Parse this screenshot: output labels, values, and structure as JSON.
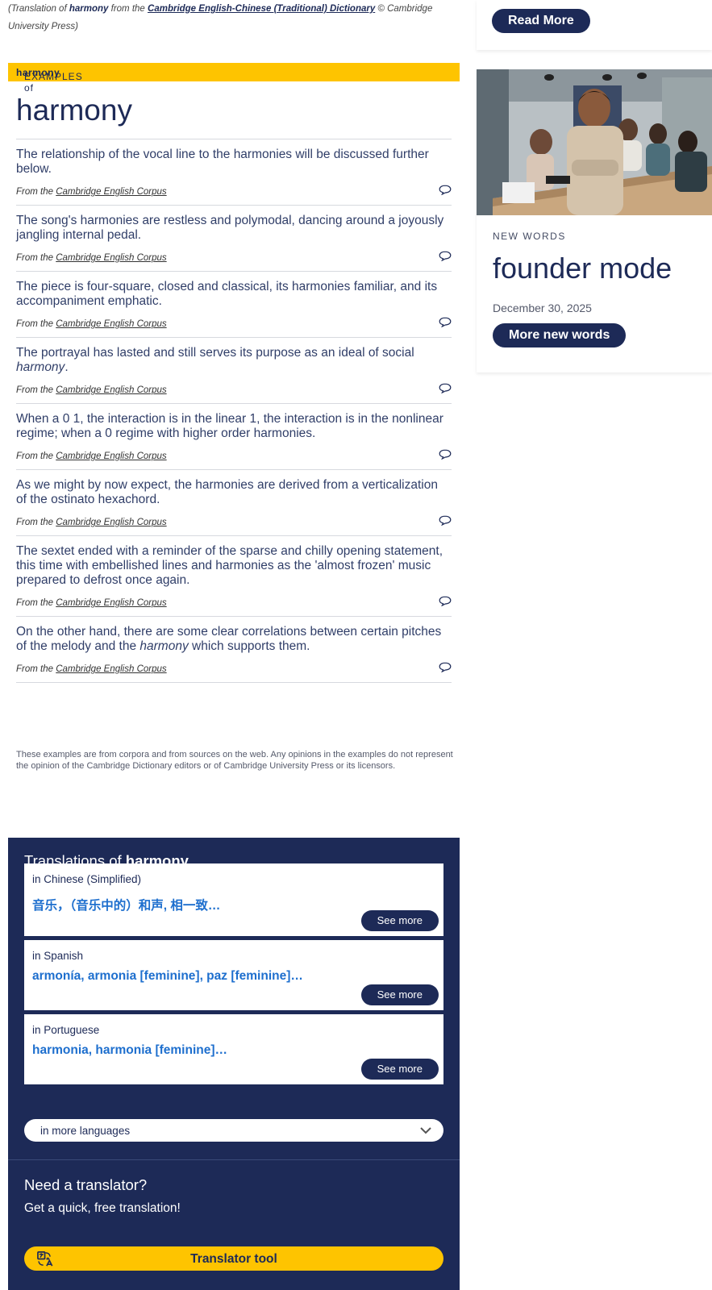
{
  "attribution": {
    "open": "(Translation of ",
    "word": "harmony",
    "from_the": " from the ",
    "dictionary": "Cambridge English-Chinese (Traditional) Dictionary",
    "close": " © Cambridge University Press)"
  },
  "examples": {
    "header_prefix": "EXAMPLES of ",
    "header_word": "harmony",
    "word": "harmony",
    "source_prefix": "From the ",
    "source_link": "Cambridge English Corpus",
    "items": [
      {
        "before": "The relationship of the vocal line to the harmonies will be discussed further below.",
        "em": "",
        "after": ""
      },
      {
        "before": "The song's harmonies are restless and polymodal, dancing around a joyously jangling internal pedal.",
        "em": "",
        "after": ""
      },
      {
        "before": "The piece is four-square, closed and classical, its harmonies familiar, and its accompaniment emphatic.",
        "em": "",
        "after": ""
      },
      {
        "before": "The portrayal has lasted and still serves its purpose as an ideal of social ",
        "em": "harmony",
        "after": "."
      },
      {
        "before": "When a 0 1, the interaction is in the linear 1, the interaction is in the nonlinear regime; when a 0 regime with higher order harmonies.",
        "em": "",
        "after": ""
      },
      {
        "before": "As we might by now expect, the harmonies are derived from a verticalization of the ostinato hexachord.",
        "em": "",
        "after": ""
      },
      {
        "before": "The sextet ended with a reminder of the sparse and chilly opening statement, this time with embellished lines and harmonies as the 'almost frozen' music prepared to defrost once again.",
        "em": "",
        "after": ""
      },
      {
        "before": "On the other hand, there are some clear correlations between certain pitches of the melody and the ",
        "em": "harmony",
        "after": " which supports them."
      }
    ],
    "disclaimer": "These examples are from corpora and from sources on the web. Any opinions in the examples do not represent the opinion of the Cambridge Dictionary editors or of Cambridge University Press or its licensors."
  },
  "translations": {
    "title_prefix": "Translations of ",
    "title_word": "harmony",
    "cards": [
      {
        "lang": "in Chinese (Simplified)",
        "words": "音乐，（音乐中的）和声, 相一致…",
        "button": "See more"
      },
      {
        "lang": "in Spanish",
        "words": "armonía, armonia [feminine], paz [feminine]…",
        "button": "See more"
      },
      {
        "lang": "in Portuguese",
        "words": "harmonia, harmonia [feminine]…",
        "button": "See more"
      }
    ],
    "more_languages": "in more languages",
    "need_translator": "Need a translator?",
    "quick_translation": "Get a quick, free translation!",
    "tool_button": "Translator tool"
  },
  "sidebar": {
    "read_more": "Read More",
    "new_words_label": "NEW WORDS",
    "new_word": "founder mode",
    "date": "December 30, 2025",
    "more_new_words": "More new words"
  },
  "colors": {
    "navy": "#1d2a57",
    "yellow": "#fec400",
    "link_blue": "#1e6fce"
  }
}
